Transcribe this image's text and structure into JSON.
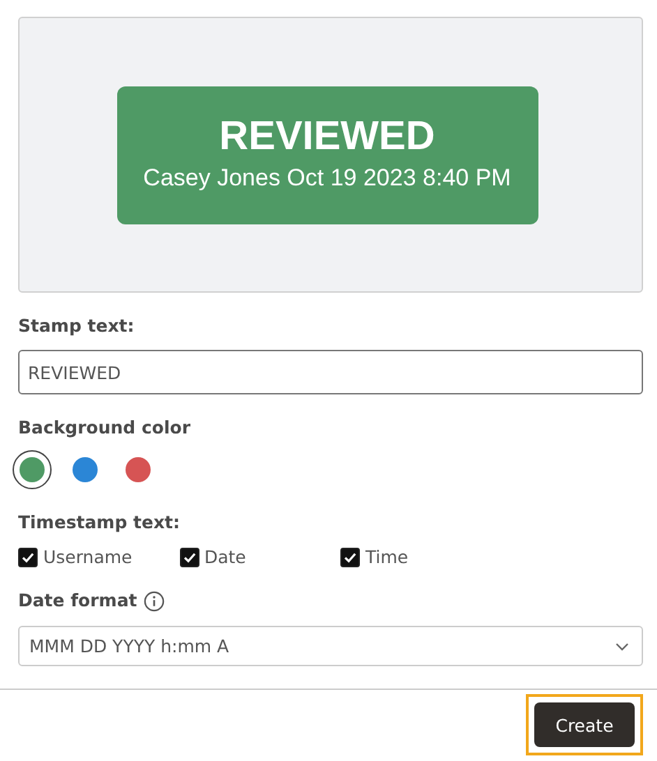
{
  "preview": {
    "stamp_title": "REVIEWED",
    "stamp_subtitle": "Casey Jones Oct 19 2023 8:40 PM"
  },
  "stamp_text": {
    "label": "Stamp text:",
    "value": "REVIEWED"
  },
  "background_color": {
    "label": "Background color",
    "swatches": [
      {
        "color": "#4f9a65",
        "selected": true
      },
      {
        "color": "#2b86d6",
        "selected": false
      },
      {
        "color": "#d65454",
        "selected": false
      }
    ]
  },
  "timestamp_text": {
    "label": "Timestamp text:",
    "options": [
      {
        "label": "Username",
        "checked": true
      },
      {
        "label": "Date",
        "checked": true
      },
      {
        "label": "Time",
        "checked": true
      }
    ]
  },
  "date_format": {
    "label": "Date format",
    "value": "MMM DD YYYY h:mm A"
  },
  "create_button": {
    "label": "Create",
    "focused": true
  }
}
